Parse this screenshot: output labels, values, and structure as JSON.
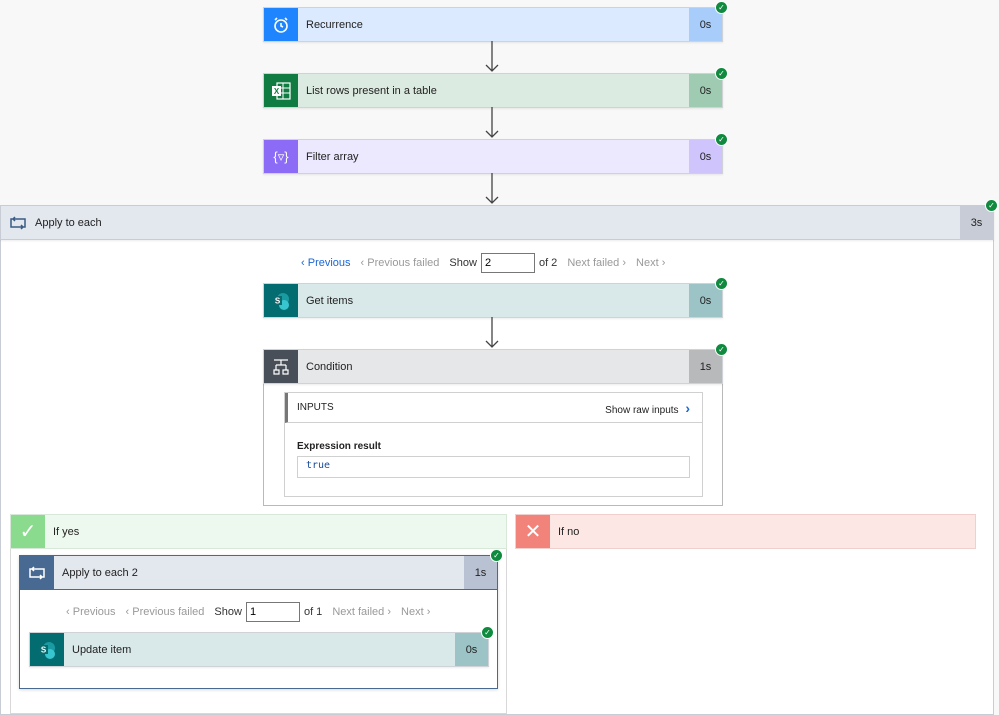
{
  "colors": {
    "success": "#0f8a3e",
    "link": "#1a66d6"
  },
  "steps": [
    {
      "title": "Recurrence",
      "duration": "0s",
      "icon": "alarm-clock-icon"
    },
    {
      "title": "List rows present in a table",
      "duration": "0s",
      "icon": "excel-icon"
    },
    {
      "title": "Filter array",
      "duration": "0s",
      "icon": "filter-array-icon"
    }
  ],
  "apply_each": {
    "title": "Apply to each",
    "duration": "3s",
    "icon": "loop-icon",
    "pager": {
      "previous": "Previous",
      "previous_failed": "Previous failed",
      "show": "Show",
      "value": "2",
      "of": "of 2",
      "next_failed": "Next failed",
      "next": "Next"
    },
    "get_items": {
      "title": "Get items",
      "duration": "0s",
      "icon": "sharepoint-icon"
    },
    "condition": {
      "title": "Condition",
      "duration": "1s",
      "icon": "condition-icon",
      "inputs_label": "INPUTS",
      "show_raw": "Show raw inputs",
      "expr_label": "Expression result",
      "expr_value": "true"
    }
  },
  "if_yes": {
    "label": "If yes",
    "apply_each2": {
      "title": "Apply to each 2",
      "duration": "1s",
      "pager": {
        "previous": "Previous",
        "previous_failed": "Previous failed",
        "show": "Show",
        "value": "1",
        "of": "of 1",
        "next_failed": "Next failed",
        "next": "Next"
      },
      "update": {
        "title": "Update item",
        "duration": "0s"
      }
    }
  },
  "if_no": {
    "label": "If no"
  }
}
